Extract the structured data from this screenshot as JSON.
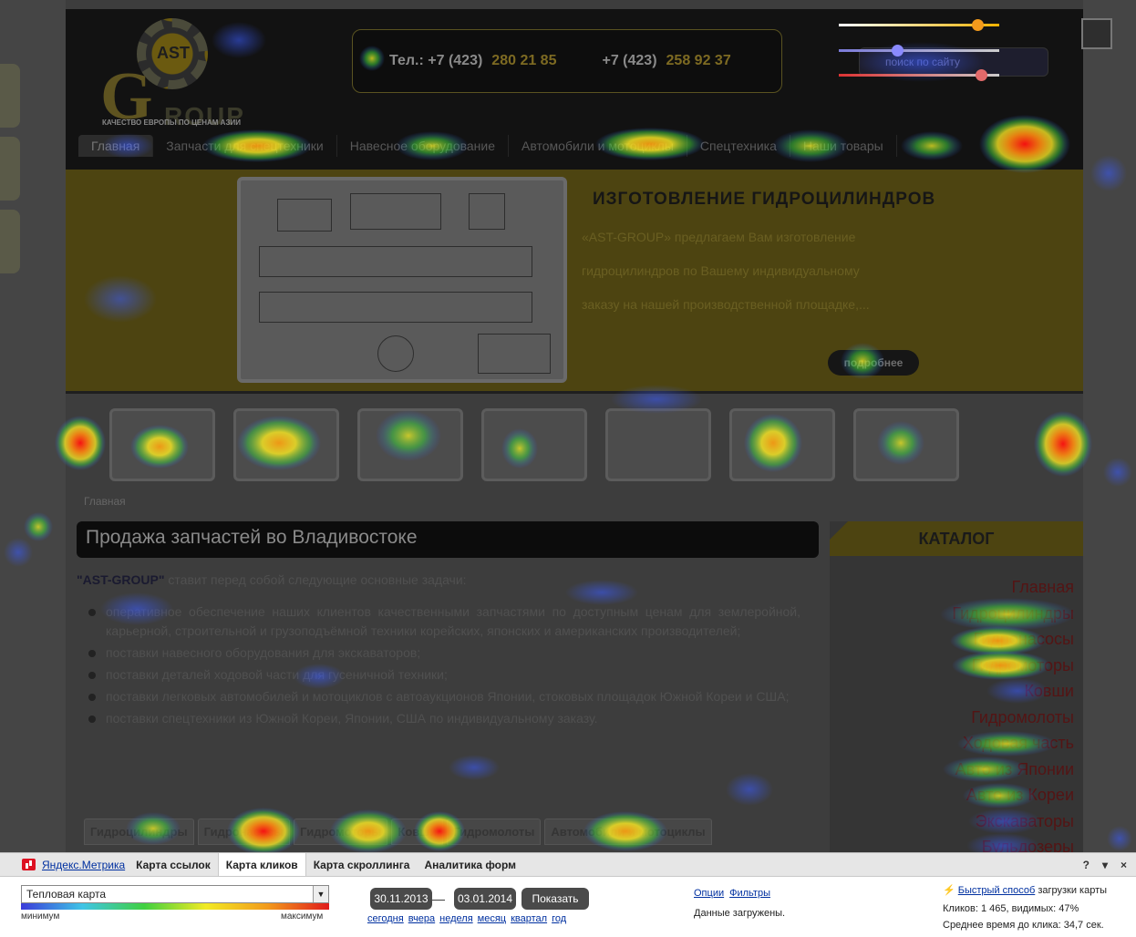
{
  "site": {
    "phone_label": "Тел.: +7 (423)",
    "phone1": "280 21 85",
    "phone2_prefix": "+7 (423)",
    "phone2": "258 92 37",
    "search_placeholder": "поиск по сайту",
    "tagline": "КАЧЕСТВО ЕВРОПЫ ПО ЦЕНАМ АЗИИ",
    "logo_text": "AST",
    "logo_g": "G",
    "logo_roup": "ROUP",
    "menu": [
      "Главная",
      "Запчасти для спецтехники",
      "Навесное оборудование",
      "Автомобили и мотоциклы",
      "Спецтехника",
      "Наши товары"
    ],
    "banner": {
      "title": "ИЗГОТОВЛЕНИЕ  ГИДРОЦИЛИНДРОВ",
      "lines": [
        "«AST-GROUP» предлагаем Вам изготовление",
        "гидроцилиндров по Вашему индивидуальному",
        "заказу на нашей производственной площадке,..."
      ],
      "more": "подробнее"
    },
    "breadcrumb": "Главная",
    "page_title": "Продажа запчастей во Владивостоке",
    "lead_bold": "\"AST-GROUP\"",
    "lead_rest": " ставит перед собой следующие основные задачи:",
    "tasks": [
      "оперативное обеспечение наших клиентов качественными запчастями по доступным ценам для землеройной, карьерной, строительной и грузоподъёмной техники корейских, японских и американских производителей;",
      "поставки навесного оборудования для экскаваторов;",
      "поставки деталей ходовой части для гусеничной техники;",
      "поставки легковых автомобилей и мотоциклов с автоаукционов Японии, стоковых площадок Южной Кореи и США;",
      "поставки спецтехники из Южной Кореи, Японии, США по индивидуальному заказу."
    ],
    "tabs": [
      "Гидроцилиндры",
      "Гидронасосы",
      "Гидромоторы",
      "Ковши",
      "Гидромолоты",
      "Автомобили и мотоциклы"
    ],
    "catalog_title": "КАТАЛОГ",
    "catalog": [
      "Главная",
      "Гидроцилиндры",
      "Гидронасосы",
      "Гидромоторы",
      "Ковши",
      "Гидромолоты",
      "Ходовая часть",
      "Авто из Японии",
      "Авто из Кореи",
      "Экскаваторы",
      "Бульдозеры"
    ]
  },
  "panel": {
    "brand": "Яндекс.Метрика",
    "tabs": [
      "Карта ссылок",
      "Карта кликов",
      "Карта скроллинга",
      "Аналитика форм"
    ],
    "active_tab": "Карта кликов",
    "help": "?",
    "collapse": "▾",
    "close": "×",
    "map_type": "Тепловая карта",
    "legend_min": "минимум",
    "legend_max": "максимум",
    "date_from": "30.11.2013",
    "date_dash": "—",
    "date_to": "03.01.2014",
    "show_button": "Показать",
    "quick_ranges": [
      "сегодня",
      "вчера",
      "неделя",
      "месяц",
      "квартал",
      "год"
    ],
    "options_link": "Опции",
    "filters_link": "Фильтры",
    "loaded": "Данные загружены.",
    "fast_load_link": "Быстрый способ",
    "fast_load_rest": " загрузки карты",
    "clicks": "Кликов: 1 465, видимых: 47%",
    "avg_time": "Среднее время до клика: 34,7 сек."
  },
  "colors": {
    "heat_low": "#3b3bd9",
    "heat_mid": "#40d040",
    "heat_warm": "#f2ea24",
    "heat_high": "#e01b1b",
    "accent": "#f2b200"
  }
}
